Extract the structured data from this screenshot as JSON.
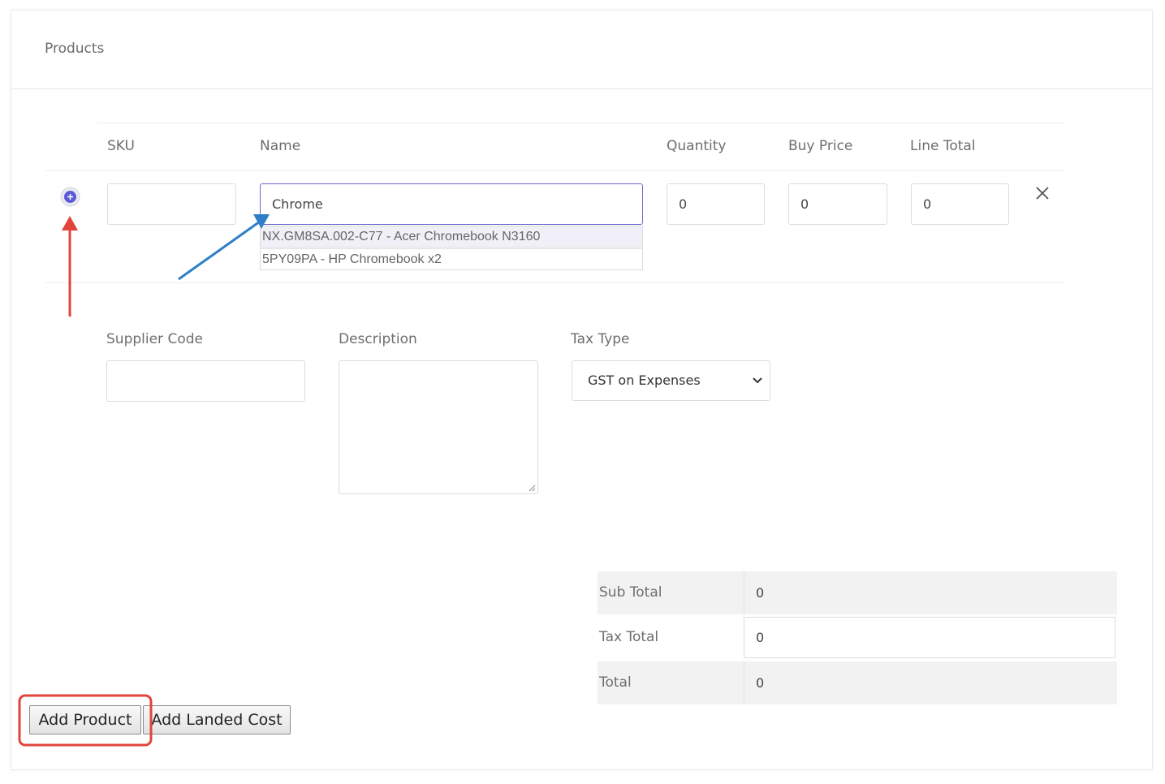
{
  "page": {
    "title": "Products"
  },
  "table": {
    "columns": [
      "SKU",
      "Name",
      "Quantity",
      "Buy Price",
      "Line Total"
    ],
    "row": {
      "sku": "",
      "name": "Chrome",
      "quantity": "0",
      "buy_price": "0",
      "line_total": "0"
    },
    "suggestions": [
      "NX.GM8SA.002-C77 - Acer Chromebook N3160",
      "5PY09PA - HP Chromebook x2"
    ]
  },
  "details": {
    "supplier_code_label": "Supplier Code",
    "supplier_code_value": "",
    "description_label": "Description",
    "description_value": "",
    "tax_type_label": "Tax Type",
    "tax_type_value": "GST on Expenses"
  },
  "totals": {
    "sub_total_label": "Sub Total",
    "sub_total_value": "0",
    "tax_total_label": "Tax Total",
    "tax_total_value": "0",
    "total_label": "Total",
    "total_value": "0"
  },
  "buttons": {
    "add_product": "Add Product",
    "add_landed_cost": "Add Landed Cost"
  },
  "colors": {
    "accent": "#5b5bd6",
    "annotation_red": "#e0443a",
    "annotation_blue": "#2f7fc8"
  },
  "icons": {
    "expand": "plus-circle-icon",
    "remove": "close-icon",
    "select": "chevron-down-icon"
  }
}
